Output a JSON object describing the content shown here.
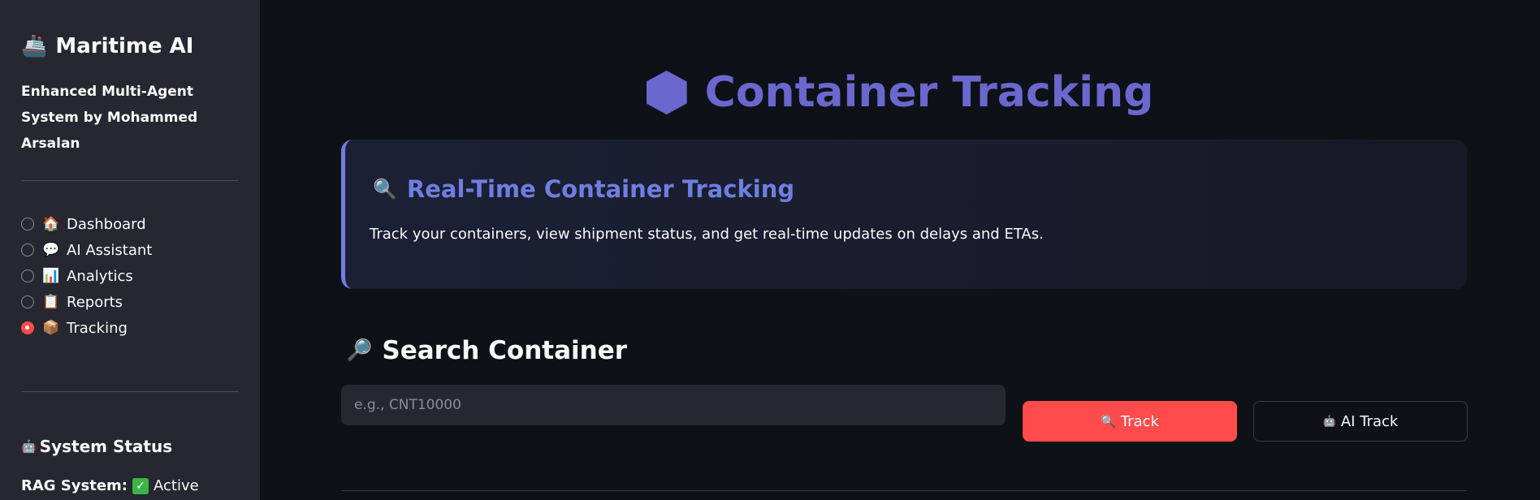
{
  "sidebar": {
    "brand_icon": "🚢",
    "brand": "Maritime AI",
    "tagline": "Enhanced Multi-Agent System by Mohammed Arsalan",
    "nav": [
      {
        "icon": "🏠",
        "label": "Dashboard",
        "selected": false
      },
      {
        "icon": "💬",
        "label": "AI Assistant",
        "selected": false
      },
      {
        "icon": "📊",
        "label": "Analytics",
        "selected": false
      },
      {
        "icon": "📋",
        "label": "Reports",
        "selected": false
      },
      {
        "icon": "📦",
        "label": "Tracking",
        "selected": true
      }
    ],
    "status_icon": "🤖",
    "status_title": "System Status",
    "rag_label": "RAG System:",
    "rag_icon": "✓",
    "rag_value": "Active"
  },
  "main": {
    "title": "Container Tracking",
    "info": {
      "icon": "🔍",
      "heading": "Real-Time Container Tracking",
      "text": "Track your containers, view shipment status, and get real-time updates on delays and ETAs."
    },
    "search": {
      "icon": "🔎",
      "title": "Search Container",
      "placeholder": "e.g., CNT10000",
      "value": ""
    },
    "buttons": {
      "track_icon": "🔍",
      "track": "Track",
      "ai_track_icon": "🤖",
      "ai_track": "AI Track"
    }
  },
  "colors": {
    "accent": "#6a67ce",
    "info_accent": "#6e7fe0",
    "primary_button": "#ff4b4b",
    "sidebar_bg": "#262730",
    "page_bg": "#0e1117"
  }
}
